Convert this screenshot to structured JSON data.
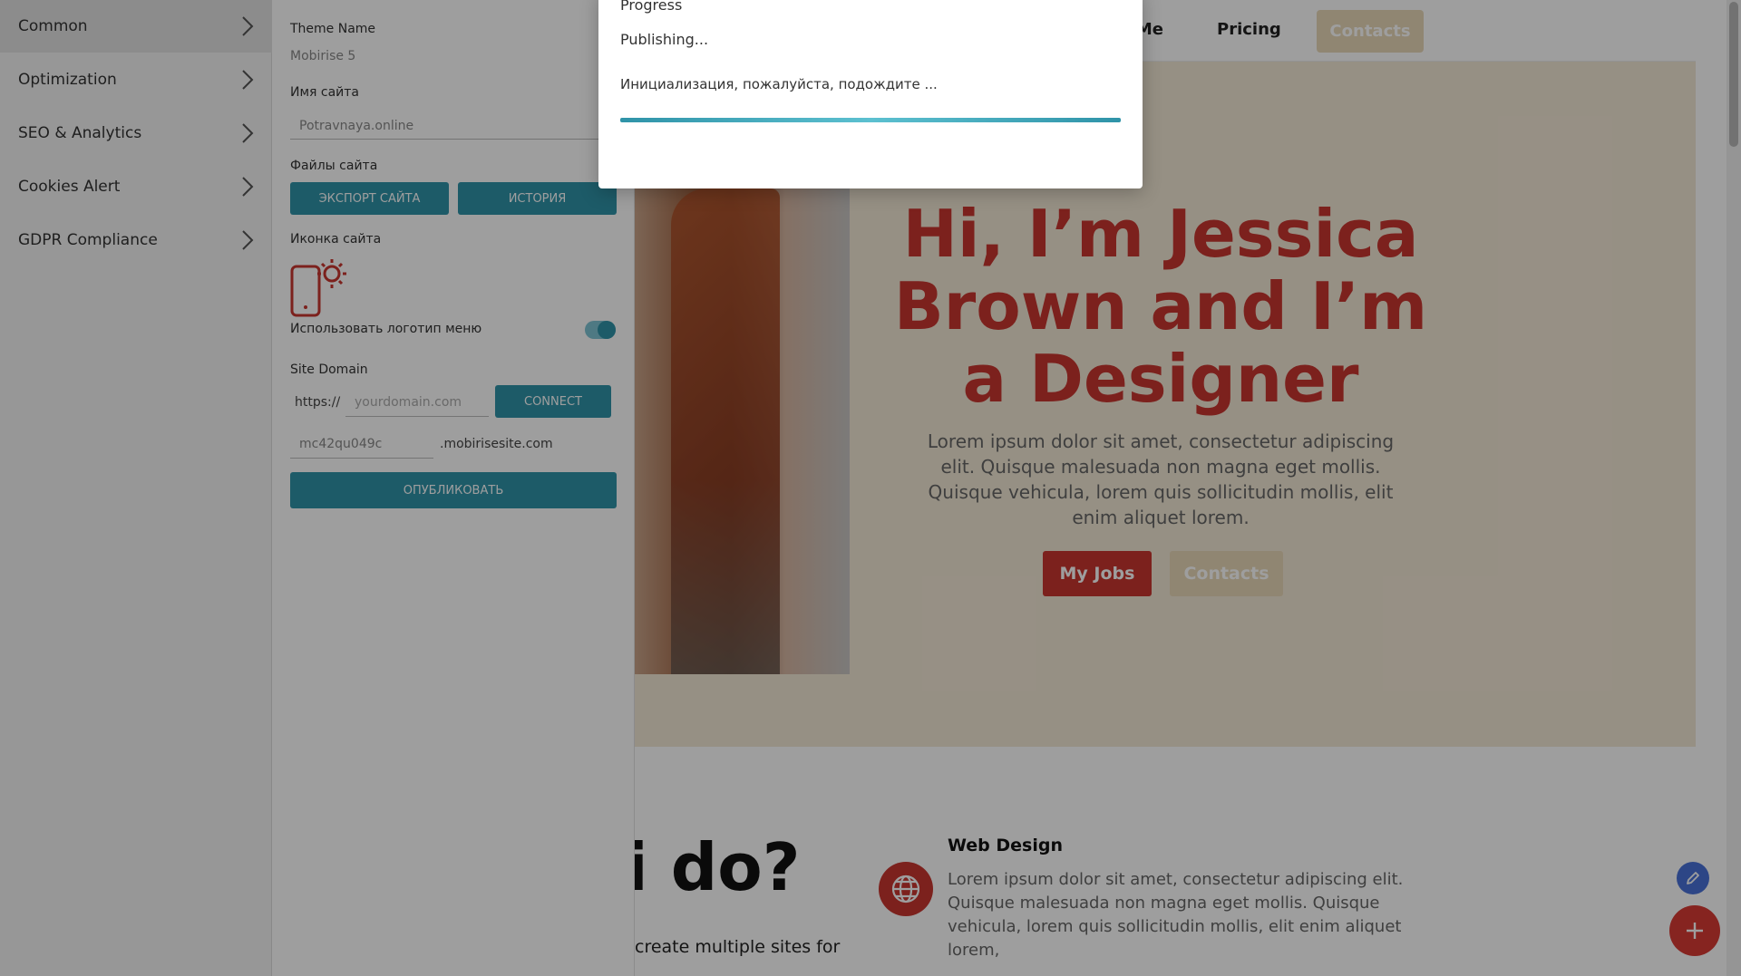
{
  "menu": {
    "items": [
      {
        "label": "Common",
        "active": true
      },
      {
        "label": "Optimization",
        "active": false
      },
      {
        "label": "SEO & Analytics",
        "active": false
      },
      {
        "label": "Cookies Alert",
        "active": false
      },
      {
        "label": "GDPR Compliance",
        "active": false
      }
    ]
  },
  "panel": {
    "theme_name_label": "Theme Name",
    "theme_name_value": "Mobirise 5",
    "site_name_label": "Имя сайта",
    "site_name_value": "Potravnaya.online",
    "site_files_label": "Файлы сайта",
    "export_button": "Экспорт сайта",
    "history_button": "История",
    "site_icon_label": "Иконка сайта",
    "use_logo_label": "Использовать логотип меню",
    "use_logo_enabled": true,
    "domain_label": "Site Domain",
    "domain_prefix": "https://",
    "domain_placeholder": "yourdomain.com",
    "connect_button": "CONNECT",
    "subdomain_value": "mc42qu049c",
    "subdomain_suffix": ".mobirisesite.com",
    "publish_button": "Опубликовать"
  },
  "modal": {
    "title": "Progress",
    "status": "Publishing...",
    "message": "Инициализация, пожалуйста, подождите ...",
    "progress": 1.0
  },
  "site": {
    "nav_partial": "t Me",
    "nav_pricing": "Pricing",
    "nav_contacts": "Contacts",
    "hero_title": "Hi, I’m Jessica Brown and I’m a Designer",
    "hero_text": "Lorem ipsum dolor sit amet, consectetur adipiscing elit. Quisque malesuada non magna eget mollis. Quisque vehicula, lorem quis sollicitudin mollis, elit enim aliquet lorem.",
    "btn_jobs": "My Jobs",
    "btn_contacts": "Contacts",
    "section_title_partial": "i do?",
    "section_sub_partial": "create multiple sites for",
    "service_title": "Web Design",
    "service_text": "Lorem ipsum dolor sit amet, consectetur adipiscing elit. Quisque malesuada non magna eget mollis. Quisque vehicula, lorem quis sollicitudin mollis, elit enim aliquet lorem,"
  },
  "colors": {
    "accent": "#2f93a8",
    "brand_red": "#c8362f",
    "sand": "#e9d8b8",
    "fab_blue": "#4a72d9"
  },
  "icons": [
    "chevron-right-icon",
    "phone-sun-icon",
    "globe-icon",
    "pencil-icon",
    "plus-icon"
  ]
}
